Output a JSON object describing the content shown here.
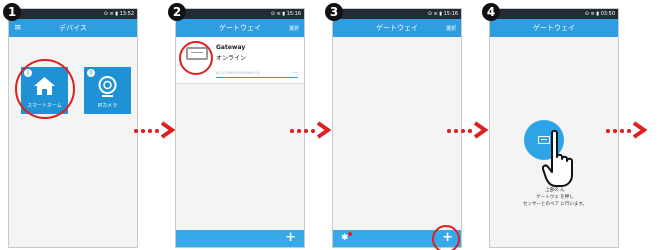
{
  "steps": [
    "1",
    "2",
    "3",
    "4"
  ],
  "status_bar": {
    "s1": {
      "right": "⊙ ≋ ▮ 13:52"
    },
    "s2": {
      "right": "⊙ ≋ ▮ 15:16"
    },
    "s3": {
      "right": "⊙ ≋ ▮ 15:16"
    },
    "s4": {
      "right": "⊙ ≋ ▮ 03:50"
    }
  },
  "screen1": {
    "title": "デバイス",
    "tiles": [
      {
        "label": "スマートホーム",
        "count": "1",
        "icon": "home-icon"
      },
      {
        "label": "IPカメラ",
        "count": "0",
        "icon": "camera-icon"
      }
    ]
  },
  "screen2": {
    "title": "ゲートウェイ",
    "action": "選択",
    "gateway": {
      "name": "Gateway",
      "status": "オンライン",
      "serial": "A11C5R60295NW9H7A",
      "more": "..."
    },
    "add_label": "+"
  },
  "screen3": {
    "title": "ゲートウェイ",
    "action": "選択",
    "add_label": "+",
    "settings_icon": "gear-icon"
  },
  "screen4": {
    "title": "ゲートウェイ",
    "instruction_lines": [
      "上部の        ん",
      "ゲートウェ        を押し",
      "センサーとのペア        に行います。"
    ]
  },
  "colors": {
    "app_bar": "#2f9ee0",
    "status_bar": "#232c36",
    "accent_red": "#e02020",
    "tile_blue": "#1f92d6"
  }
}
